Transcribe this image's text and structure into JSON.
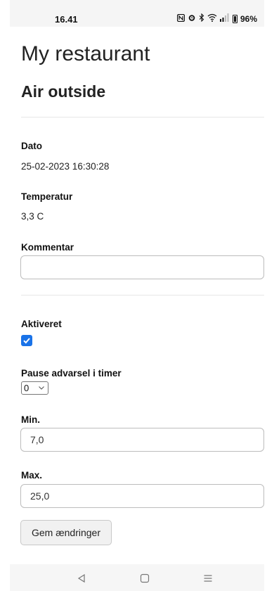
{
  "status_bar": {
    "time": "16.41",
    "icons": [
      "nfc-icon",
      "alarm-icon",
      "bluetooth-icon",
      "wifi-icon",
      "signal-icon",
      "battery-icon"
    ],
    "battery": "96%"
  },
  "header": {
    "app_title": "My restaurant",
    "subtitle": "Air outside"
  },
  "details": {
    "date_label": "Dato",
    "date_value": "25-02-2023 16:30:28",
    "temperature_label": "Temperatur",
    "temperature_value": "3,3 C",
    "comment_label": "Kommentar",
    "comment_value": ""
  },
  "settings": {
    "active_label": "Aktiveret",
    "active_checked": true,
    "pause_label": "Pause advarsel i timer",
    "pause_value": "0",
    "min_label": "Min.",
    "min_value": "7,0",
    "max_label": "Max.",
    "max_value": "25,0",
    "save_label": "Gem ændringer"
  },
  "nav_bar": {
    "icons": [
      "back-icon",
      "home-icon",
      "menu-icon"
    ]
  },
  "colors": {
    "checkbox_accent": "#1a73e8"
  }
}
